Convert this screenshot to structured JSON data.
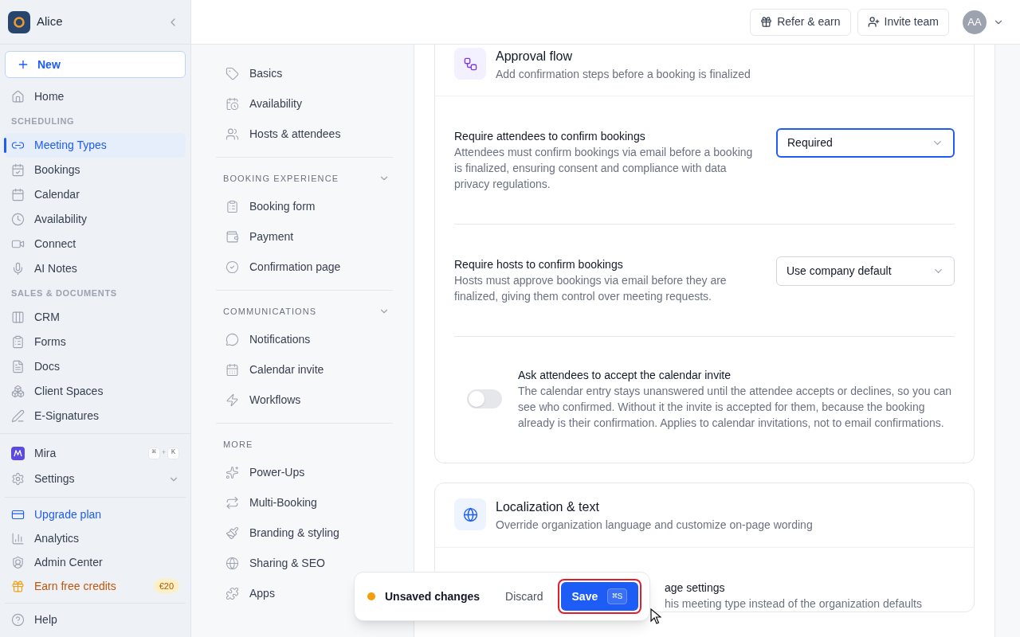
{
  "sidebar": {
    "workspace": "Alice",
    "new_button": "New",
    "nav": [
      {
        "kind": "item",
        "label": "Home",
        "selected": false
      },
      {
        "kind": "heading",
        "label": "SCHEDULING"
      },
      {
        "kind": "item",
        "label": "Meeting Types",
        "selected": true
      },
      {
        "kind": "item",
        "label": "Bookings",
        "selected": false
      },
      {
        "kind": "item",
        "label": "Calendar",
        "selected": false
      },
      {
        "kind": "item",
        "label": "Availability",
        "selected": false
      },
      {
        "kind": "item",
        "label": "Connect",
        "selected": false
      },
      {
        "kind": "item",
        "label": "AI Notes",
        "selected": false
      },
      {
        "kind": "heading",
        "label": "SALES & DOCUMENTS"
      },
      {
        "kind": "item",
        "label": "CRM",
        "selected": false
      },
      {
        "kind": "item",
        "label": "Forms",
        "selected": false
      },
      {
        "kind": "item",
        "label": "Docs",
        "selected": false
      },
      {
        "kind": "item",
        "label": "Client Spaces",
        "selected": false
      },
      {
        "kind": "item",
        "label": "E-Signatures",
        "selected": false
      }
    ],
    "assistant": {
      "label": "Mira",
      "shortcut": [
        "⌘",
        "+",
        "K"
      ]
    },
    "settings": {
      "label": "Settings",
      "expanded": false
    },
    "footer": [
      {
        "label": "Upgrade plan",
        "kind": "accent"
      },
      {
        "label": "Analytics",
        "kind": "plain"
      },
      {
        "label": "Admin Center",
        "kind": "plain"
      },
      {
        "label": "Earn free credits",
        "kind": "promo",
        "badge": "€20"
      }
    ],
    "help": "Help"
  },
  "topbar": {
    "buttons": [
      "Refer & earn",
      "Invite team"
    ],
    "avatar": "AA"
  },
  "subnav": [
    {
      "items": [
        {
          "label": "Basics",
          "selected": false
        },
        {
          "label": "Availability",
          "selected": false
        },
        {
          "label": "Hosts & attendees",
          "selected": false
        }
      ]
    },
    {
      "heading": "BOOKING EXPERIENCE",
      "expanded": true,
      "items": [
        {
          "label": "Booking form",
          "selected": false
        },
        {
          "label": "Payment",
          "selected": false
        },
        {
          "label": "Confirmation page",
          "selected": false
        }
      ]
    },
    {
      "heading": "COMMUNICATIONS",
      "expanded": true,
      "items": [
        {
          "label": "Notifications",
          "selected": false
        },
        {
          "label": "Calendar invite",
          "selected": false
        },
        {
          "label": "Workflows",
          "selected": false
        }
      ]
    },
    {
      "heading": "MORE",
      "items": [
        {
          "label": "Power-Ups",
          "selected": false
        },
        {
          "label": "Multi-Booking",
          "selected": false
        },
        {
          "label": "Branding & styling",
          "selected": false
        },
        {
          "label": "Sharing & SEO",
          "selected": false
        },
        {
          "label": "Apps",
          "selected": false
        }
      ]
    }
  ],
  "cards": [
    {
      "title": "Approval flow",
      "subtitle": "Add confirmation steps before a booking is finalized",
      "kind": "approval",
      "settings": [
        {
          "kind": "select",
          "label": "Require attendees to confirm bookings",
          "description": "Attendees must confirm bookings via email before a booking is finalized, ensuring consent and compliance with data privacy regulations.",
          "value": "Required",
          "focused": true
        },
        {
          "kind": "select",
          "label": "Require hosts to confirm bookings",
          "description": "Hosts must approve bookings via email before they are finalized, giving them control over meeting requests.",
          "value": "Use company default",
          "focused": false
        },
        {
          "kind": "toggle",
          "label": "Ask attendees to accept the calendar invite",
          "description": "The calendar entry stays unanswered until the attendee accepts or declines, so you can see who confirmed. Without it the invite is accepted for them, because the booking already is their confirmation. Applies to calendar invitations, not to email confirmations.",
          "on": false
        }
      ]
    },
    {
      "title": "Localization & text",
      "subtitle": "Override organization language and customize on-page wording",
      "kind": "localization",
      "settings": [
        {
          "kind": "partial",
          "label": "age settings",
          "description": "his meeting type instead of the organization defaults"
        }
      ]
    }
  ],
  "toast": {
    "message": "Unsaved changes",
    "discard": "Discard",
    "save": "Save",
    "shortcut": "⌘S",
    "highlighted": true
  }
}
